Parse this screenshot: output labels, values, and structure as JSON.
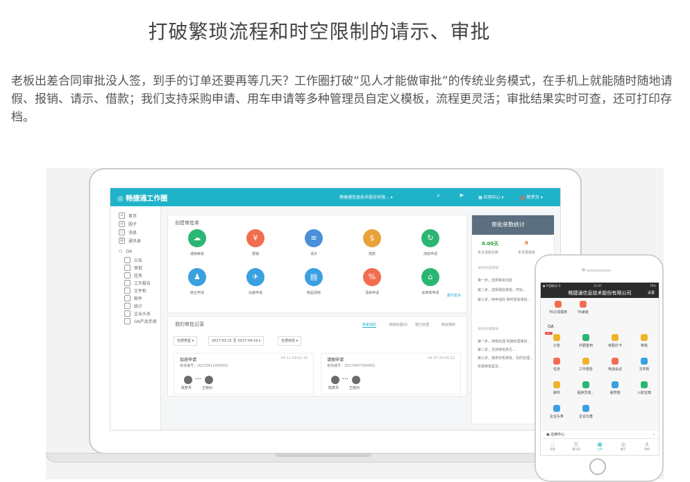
{
  "page": {
    "headline": "打破繁琐流程和时空限制的请示、审批",
    "paragraph": "老板出差合同审批没人签，到手的订单还要再等几天？工作圈打破“见人才能做审批”的传统业务模式，在手机上就能随时随地请假、报销、请示、借款；我们支持采购申请、用车申请等多种管理员自定义模板，流程更灵活；审批结果实时可查，还可打印存档。"
  },
  "desktop": {
    "topbar": {
      "logo": "畅捷通工作圈",
      "company": "畅捷通信息技术股份有限...",
      "app_center": "应用中心",
      "user": "陈梦月"
    },
    "sidebar": {
      "main": [
        "首页",
        "圈子",
        "消息",
        "通讯录"
      ],
      "oa_label": "OA",
      "oa_items": [
        "公告",
        "审批",
        "任务",
        "工作报告",
        "文件柜",
        "邮件",
        "统计",
        "企业头条",
        "OA产品手册"
      ]
    },
    "create_panel": {
      "title": "创建审批单",
      "templates": [
        {
          "label": "通用审批",
          "color": "#2bb673",
          "glyph": "☁"
        },
        {
          "label": "报销",
          "color": "#f26d4f",
          "glyph": "¥"
        },
        {
          "label": "请示",
          "color": "#4a90d9",
          "glyph": "≡"
        },
        {
          "label": "借款",
          "color": "#e8a23b",
          "glyph": "$"
        },
        {
          "label": "加班申请",
          "color": "#2bb673",
          "glyph": "↻"
        },
        {
          "label": "转正申请",
          "color": "#3aa0e0",
          "glyph": "♟"
        },
        {
          "label": "出差申请",
          "color": "#3aa0e0",
          "glyph": "✈"
        },
        {
          "label": "物品领用",
          "color": "#3aa0e0",
          "glyph": "▤"
        },
        {
          "label": "请休申请",
          "color": "#f26d4f",
          "glyph": "%"
        },
        {
          "label": "采用章申请",
          "color": "#2bb673",
          "glyph": "⌂"
        }
      ],
      "more": "展开更多"
    },
    "records_panel": {
      "title": "我的审批记录",
      "tabs": [
        "我审请的",
        "待我处理(0)",
        "我已处理",
        "知会我的"
      ],
      "filters": [
        "全部类型",
        "2017-03-21 至 2017-04-19",
        "全部状态"
      ],
      "cards": [
        {
          "title": "加班申请",
          "number": "审批编号：20170411000002",
          "time": "04-11 09:52:16",
          "names": [
            "陈梦月",
            "王丽州"
          ]
        },
        {
          "title": "请假申请",
          "number": "审批编号：20170407000001",
          "time": "04-07 09:46:52",
          "names": [
            "陈梦月",
            "王丽州"
          ]
        }
      ]
    },
    "stats_panel": {
      "title": "审批单数统计",
      "values": [
        {
          "value": "0.00天",
          "label": "本月请假天数"
        },
        {
          "value": "0",
          "label": "本月报销单"
        }
      ],
      "section1_title": "如何发起审批",
      "section1_steps": [
        "第一步，选择审批功能",
        "第二步，选择相应审批，开始...",
        "第三步，到申请的 随时查看审批..."
      ],
      "section2_title": "如何处理审批",
      "section2_steps": [
        "第一步，待我处理 快捷处理审批...",
        "第二步，支持审批意见...",
        "第三步，使用手机审批，及时处理...",
        "实施审批留言..."
      ]
    }
  },
  "phone": {
    "status_left": "● 中国移动 令",
    "status_time": "11:07",
    "status_right": "70%",
    "header": "畅捷通信息技术股份有限公司",
    "header_action": "设置",
    "top_apps": [
      "T6订阅报表",
      "T6审批"
    ],
    "oa_label": "OA",
    "apps": [
      {
        "label": "公告",
        "color": "#f0b429",
        "badge": "New"
      },
      {
        "label": "外勤签到",
        "color": "#2bb673"
      },
      {
        "label": "考勤打卡",
        "color": "#f0b429"
      },
      {
        "label": "审批",
        "color": "#f0b429"
      },
      {
        "label": "任务",
        "color": "#f26d4f"
      },
      {
        "label": "工作报告",
        "color": "#f0b429"
      },
      {
        "label": "电话会议",
        "color": "#f26d4f"
      },
      {
        "label": "文件柜",
        "color": "#3aa0e0"
      },
      {
        "label": "邮件",
        "color": "#f0b429"
      },
      {
        "label": "程序员老...",
        "color": "#2bb673"
      },
      {
        "label": "悬赏榜",
        "color": "#3aa0e0"
      },
      {
        "label": "入职宝典",
        "color": "#2bb673"
      },
      {
        "label": "企业头条",
        "color": "#3aa0e0"
      },
      {
        "label": "企业云盘",
        "color": "#3aa0e0"
      }
    ],
    "app_center": "应用中心",
    "tabs": [
      "消息",
      "通讯录",
      "工作",
      "圈子",
      "我的"
    ]
  }
}
